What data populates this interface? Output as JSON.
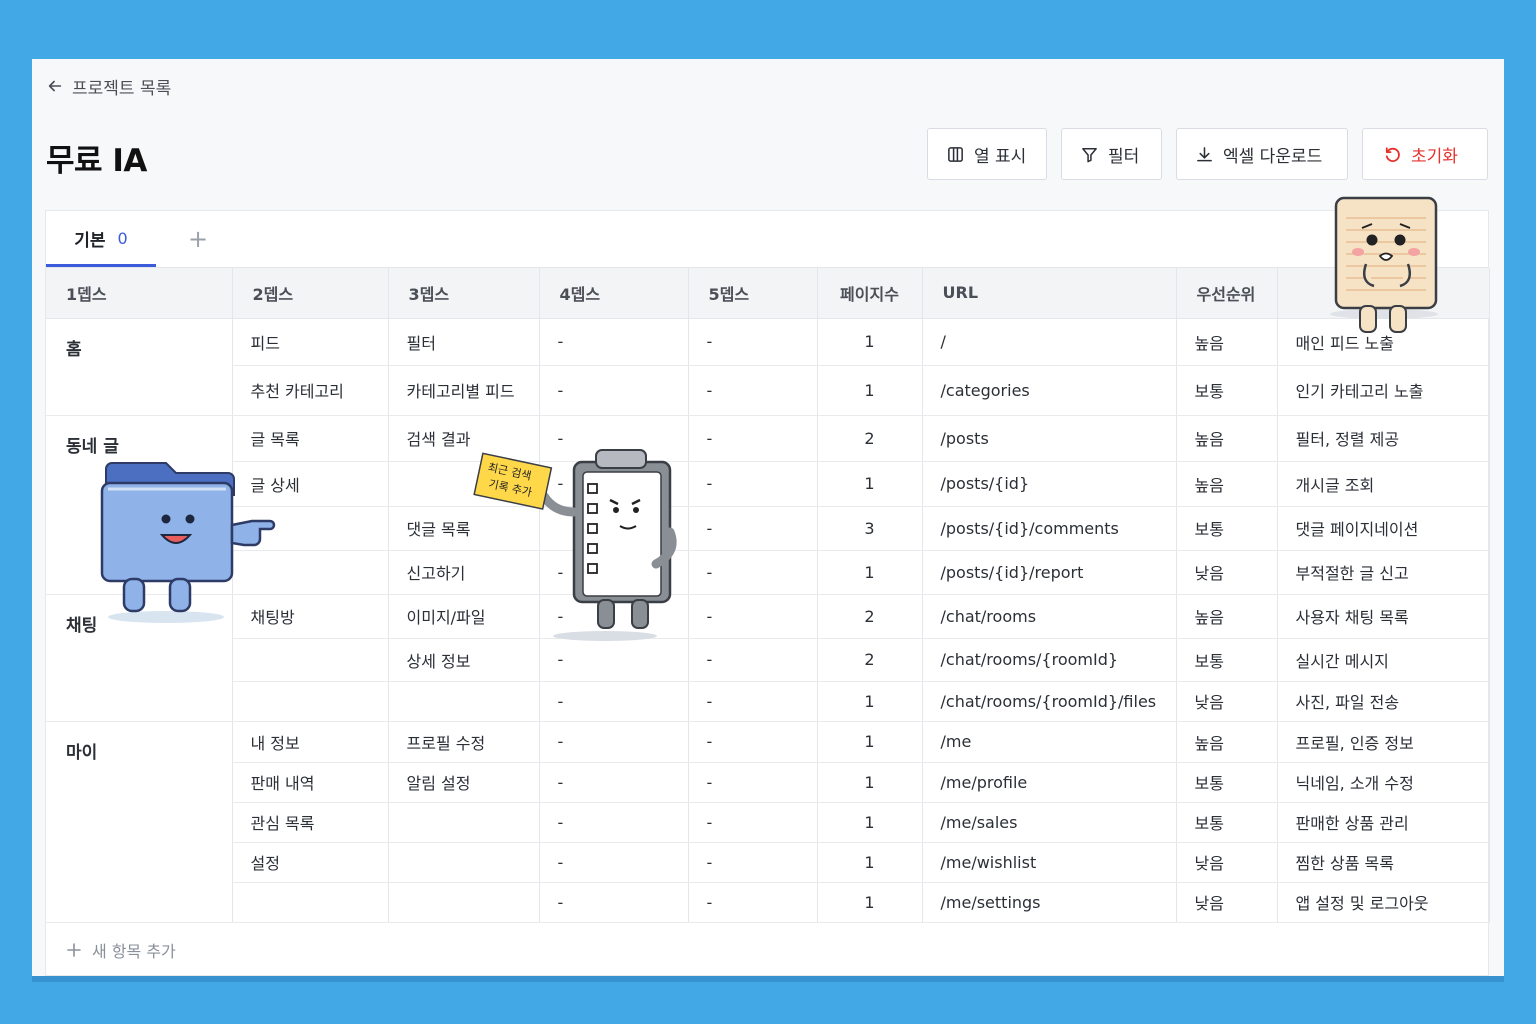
{
  "nav": {
    "back_label": "프로젝트 목록"
  },
  "page": {
    "title": "무료 IA"
  },
  "toolbar": {
    "columns_label": "열 표시",
    "filter_label": "필터",
    "download_label": "엑셀 다운로드",
    "reset_label": "초기화"
  },
  "tabs": [
    {
      "label": "기본",
      "count": "0"
    }
  ],
  "tab_add_label": "+",
  "table": {
    "headers": [
      "1뎁스",
      "2뎁스",
      "3뎁스",
      "4뎁스",
      "5뎁스",
      "페이지수",
      "URL",
      "우선순위",
      ""
    ],
    "groups": [
      "홈",
      "동네 글",
      "채팅",
      "마이"
    ],
    "rows": [
      [
        "피드",
        "필터",
        "-",
        "-",
        "1",
        "/",
        "높음",
        "매인 피드 노출"
      ],
      [
        "추천 카테고리",
        "카테고리별 피드",
        "-",
        "-",
        "1",
        "/categories",
        "보통",
        "인기 카테고리 노출"
      ],
      [
        "글 목록",
        "검색 결과",
        "-",
        "-",
        "2",
        "/posts",
        "높음",
        "필터, 정렬 제공"
      ],
      [
        "글 상세",
        "",
        "-",
        "-",
        "1",
        "/posts/{id}",
        "높음",
        "개시글 조회"
      ],
      [
        "",
        "댓글 목록",
        "",
        "-",
        "3",
        "/posts/{id}/comments",
        "보통",
        "댓글 페이지네이션"
      ],
      [
        "",
        "신고하기",
        "-",
        "-",
        "1",
        "/posts/{id}/report",
        "낮음",
        "부적절한 글 신고"
      ],
      [
        "채팅방",
        "이미지/파일",
        "-",
        "-",
        "2",
        "/chat/rooms",
        "높음",
        "사용자 채팅 목록"
      ],
      [
        "",
        "상세 정보",
        "-",
        "-",
        "2",
        "/chat/rooms/{roomId}",
        "보통",
        "실시간 메시지"
      ],
      [
        "",
        "",
        "-",
        "-",
        "1",
        "/chat/rooms/{roomId}/files",
        "낮음",
        "사진, 파일 전송"
      ],
      [
        "내 정보",
        "프로필 수정",
        "-",
        "-",
        "1",
        "/me",
        "높음",
        "프로필, 인증 정보"
      ],
      [
        "판매 내역",
        "알림 설정",
        "-",
        "-",
        "1",
        "/me/profile",
        "보통",
        "닉네임, 소개 수정"
      ],
      [
        "관심 목록",
        "",
        "-",
        "-",
        "1",
        "/me/sales",
        "보통",
        "판매한 상품 관리"
      ],
      [
        "설정",
        "",
        "-",
        "-",
        "1",
        "/me/wishlist",
        "낮음",
        "찜한 상품 목록"
      ],
      [
        "",
        "",
        "-",
        "-",
        "1",
        "/me/settings",
        "낮음",
        "앱 설정 및 로그아웃"
      ]
    ]
  },
  "add_row_label": "새 항목 추가",
  "sticky_note": {
    "line1": "최근 검색",
    "line2": "기록 추가"
  },
  "colors": {
    "accent": "#3b5bdb",
    "danger": "#e5322d",
    "background": "#43a8e6"
  },
  "icons": [
    "arrow-left-icon",
    "columns-icon",
    "filter-icon",
    "download-icon",
    "reset-icon",
    "plus-icon"
  ]
}
